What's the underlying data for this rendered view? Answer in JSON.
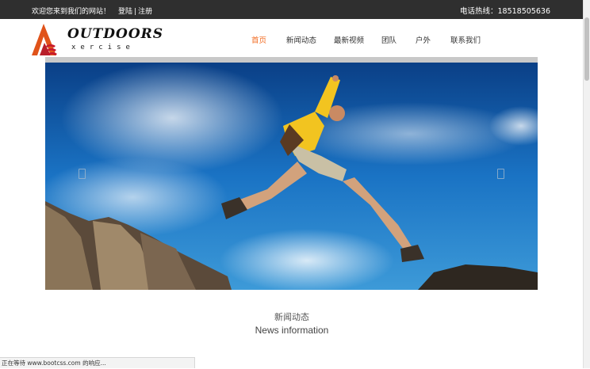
{
  "topbar": {
    "welcome": "欢迎您来到我们的网站！",
    "login": "登陆",
    "separator": "|",
    "register": "注册",
    "phone": "电话热线：18518505636"
  },
  "logo": {
    "word": "OUTDOORS",
    "sub": "xercise"
  },
  "nav": {
    "items": [
      {
        "label": "首页",
        "active": true
      },
      {
        "label": "新闻动态"
      },
      {
        "label": "最新视频"
      },
      {
        "label": "团队"
      },
      {
        "label": "户外"
      },
      {
        "label": "联系我们"
      }
    ]
  },
  "section": {
    "title_cn": "新闻动态",
    "title_en": "News information"
  },
  "status_bar": "正在等待 www.bootcss.com 的响应...",
  "colors": {
    "accent": "#f26b21",
    "topbar": "#2f2f2f"
  }
}
